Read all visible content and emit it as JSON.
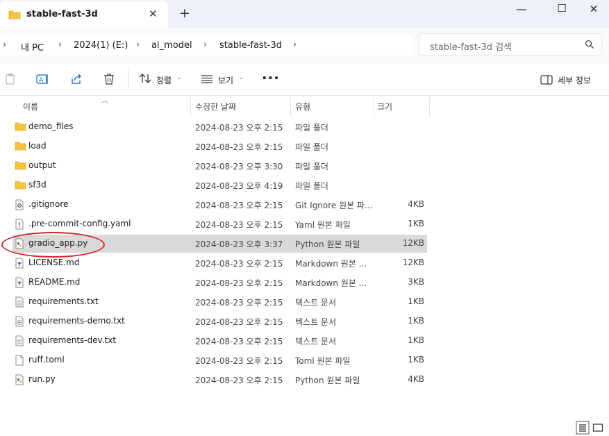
{
  "window": {
    "tab_title": "stable-fast-3d",
    "new_tab_symbol": "+",
    "close_tab_symbol": "✕",
    "minimize_symbol": "—",
    "maximize_symbol": "☐",
    "close_symbol": "✕"
  },
  "address": {
    "breadcrumb": [
      "내 PC",
      "2024(1) (E:)",
      "ai_model",
      "stable-fast-3d"
    ],
    "search_placeholder": "stable-fast-3d 검색"
  },
  "toolbar": {
    "sort_label": "정렬",
    "view_label": "보기",
    "more_label": "···",
    "details_label": "세부 정보"
  },
  "columns": {
    "name": "이름",
    "date": "수정한 날짜",
    "type": "유형",
    "size": "크기"
  },
  "files": [
    {
      "name": "demo_files",
      "date": "2024-08-23 오후 2:15",
      "type": "파일 폴더",
      "size": "",
      "icon": "folder-icon"
    },
    {
      "name": "load",
      "date": "2024-08-23 오후 2:15",
      "type": "파일 폴더",
      "size": "",
      "icon": "folder-icon"
    },
    {
      "name": "output",
      "date": "2024-08-23 오후 3:30",
      "type": "파일 폴더",
      "size": "",
      "icon": "folder-icon"
    },
    {
      "name": "sf3d",
      "date": "2024-08-23 오후 4:19",
      "type": "파일 폴더",
      "size": "",
      "icon": "folder-icon"
    },
    {
      "name": ".gitignore",
      "date": "2024-08-23 오후 2:15",
      "type": "Git Ignore 원본 파...",
      "size": "4KB",
      "icon": "gear-file-icon"
    },
    {
      "name": ".pre-commit-config.yaml",
      "date": "2024-08-23 오후 2:15",
      "type": "Yaml 원본 파일",
      "size": "1KB",
      "icon": "warning-file-icon"
    },
    {
      "name": "gradio_app.py",
      "date": "2024-08-23 오후 3:37",
      "type": "Python 원본 파일",
      "size": "12KB",
      "icon": "python-file-icon"
    },
    {
      "name": "LICENSE.md",
      "date": "2024-08-23 오후 2:15",
      "type": "Markdown 원본 ...",
      "size": "12KB",
      "icon": "markdown-file-icon"
    },
    {
      "name": "README.md",
      "date": "2024-08-23 오후 2:15",
      "type": "Markdown 원본 ...",
      "size": "3KB",
      "icon": "markdown-file-icon"
    },
    {
      "name": "requirements.txt",
      "date": "2024-08-23 오후 2:15",
      "type": "텍스트 문서",
      "size": "1KB",
      "icon": "text-file-icon"
    },
    {
      "name": "requirements-demo.txt",
      "date": "2024-08-23 오후 2:15",
      "type": "텍스트 문서",
      "size": "1KB",
      "icon": "text-file-icon"
    },
    {
      "name": "requirements-dev.txt",
      "date": "2024-08-23 오후 2:15",
      "type": "텍스트 문서",
      "size": "1KB",
      "icon": "text-file-icon"
    },
    {
      "name": "ruff.toml",
      "date": "2024-08-23 오후 2:15",
      "type": "Toml 원본 파일",
      "size": "1KB",
      "icon": "blank-file-icon"
    },
    {
      "name": "run.py",
      "date": "2024-08-23 오후 2:15",
      "type": "Python 원본 파일",
      "size": "4KB",
      "icon": "python-file-icon"
    }
  ],
  "selected_file": "gradio_app.py",
  "colors": {
    "accent": "#0067c0",
    "folder": "#f4c542",
    "selection": "#d9d9d9",
    "highlight_ring": "#d6262b"
  }
}
